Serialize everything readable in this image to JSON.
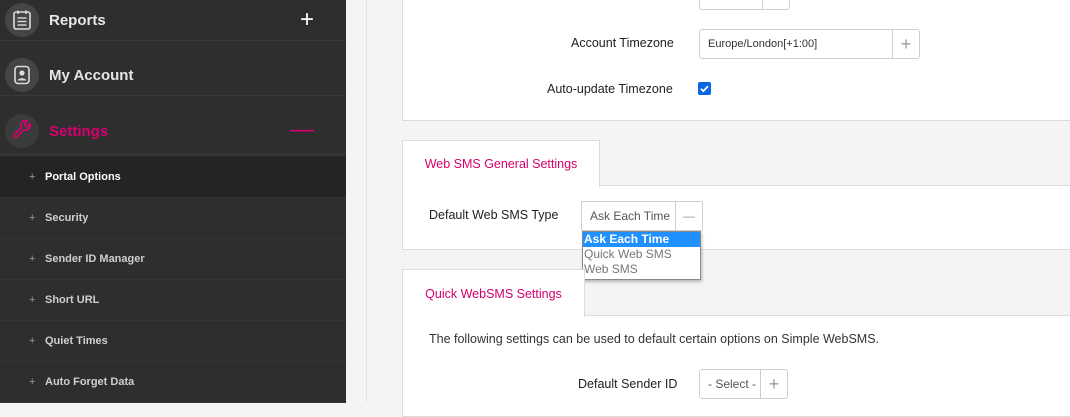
{
  "sidebar": {
    "items": [
      {
        "label": "Reports",
        "toggle": "+"
      },
      {
        "label": "My Account"
      },
      {
        "label": "Settings",
        "toggle": "—"
      }
    ],
    "sub_items": [
      {
        "label": "Portal Options"
      },
      {
        "label": "Security"
      },
      {
        "label": "Sender ID Manager"
      },
      {
        "label": "Short URL"
      },
      {
        "label": "Quiet Times"
      },
      {
        "label": "Auto Forget Data"
      }
    ],
    "sub_prefix": "+"
  },
  "account": {
    "timezone_label": "Account Timezone",
    "timezone_value": "Europe/London[+1:00]",
    "timezone_add": "+",
    "auto_update_label": "Auto-update Timezone",
    "auto_update_checked": true
  },
  "web_sms": {
    "tab_label": "Web SMS General Settings",
    "type_label": "Default Web SMS Type",
    "type_value": "Ask Each Time",
    "type_addon": "—",
    "options": [
      "Ask Each Time",
      "Quick Web SMS",
      "Web SMS"
    ],
    "selected_option": "Ask Each Time"
  },
  "quick": {
    "tab_label": "Quick WebSMS Settings",
    "description": "The following settings can be used to default certain options on Simple WebSMS.",
    "sender_label": "Default Sender ID",
    "sender_value": "- Select -",
    "sender_add": "+"
  },
  "colors": {
    "accent": "#d6006e",
    "sidebar_bg": "#2e2e2e",
    "highlight": "#1e90ff"
  }
}
